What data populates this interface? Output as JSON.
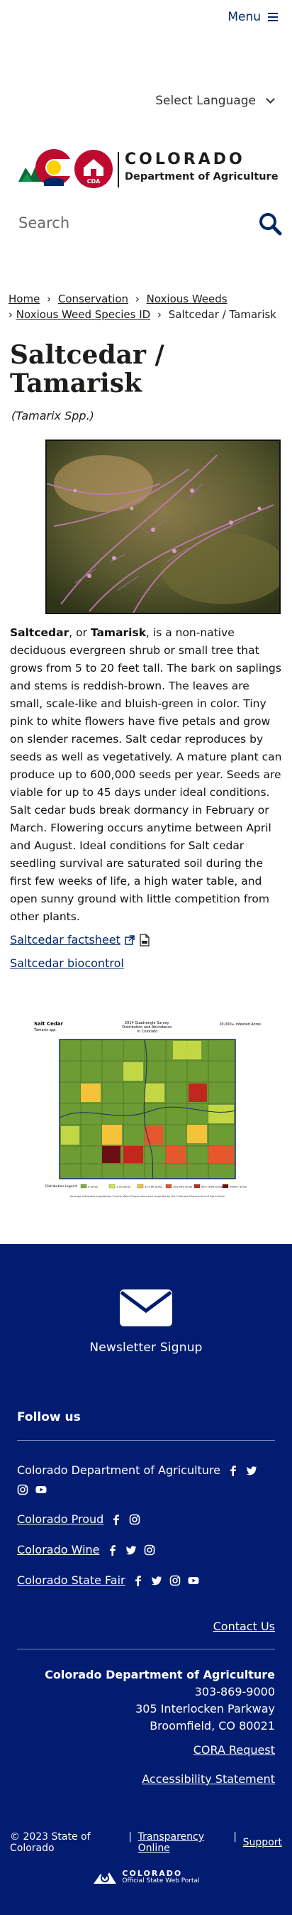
{
  "header": {
    "menu_label": "Menu",
    "language_label": "Select Language",
    "logo_line1": "COLORADO",
    "logo_line2": "Department of Agriculture",
    "logo_badge": "CDA",
    "search_placeholder": "Search"
  },
  "breadcrumb": {
    "items": [
      "Home",
      "Conservation",
      "Noxious Weeds",
      "Noxious Weed Species ID"
    ],
    "current": "Saltcedar / Tamarisk",
    "separator": "›"
  },
  "main": {
    "title": "Saltcedar / Tamarisk",
    "scientific_name": "(Tamarix Spp.)",
    "description_bold1": "Saltcedar",
    "description_mid": ", or ",
    "description_bold2": "Tamarisk",
    "description_rest": ", is a non-native deciduous evergreen shrub or small tree that grows from 5 to 20 feet tall. The bark on saplings and stems is reddish-brown. The leaves are small, scale-like and bluish-green in color. Tiny pink to white flowers have five petals and grow on slender racemes. Salt cedar reproduces by seeds as well as vegetatively. A mature plant can produce up to 600,000 seeds per year. Seeds are viable for up to 45 days under ideal conditions. Salt cedar buds break dormancy in February or March. Flowering occurs anytime between April and August. Ideal conditions for Salt cedar seedling survival are saturated soil during the first few weeks of life, a high water table, and open sunny ground with little competition from other plants.",
    "factsheet_link": "Saltcedar factsheet",
    "biocontrol_link": "Saltcedar biocontrol",
    "map": {
      "title_left": "Salt Cedar",
      "subtitle_left": "Tamarix spp.",
      "title_center": "2014 Quadrangle Survey\nDistribution and Abundance\nIn Colorado",
      "title_right": "20,000+ infested Acres",
      "legend_title": "Distribution Legend:",
      "legend": [
        {
          "label": "0 acres",
          "color": "#7fb03a"
        },
        {
          "label": "1-10 acres",
          "color": "#d8e64a"
        },
        {
          "label": "11-100 acres",
          "color": "#f3c33a"
        },
        {
          "label": "101-500 acres",
          "color": "#e5572c"
        },
        {
          "label": "501-1000 acres",
          "color": "#c0281e"
        },
        {
          "label": "1000+ acres",
          "color": "#6a0f12"
        }
      ],
      "footnote": "Acreage estimates supplied by County Weed Supervisors and compiled by the Colorado Department of Agriculture"
    }
  },
  "footer": {
    "newsletter_label": "Newsletter Signup",
    "follow_title": "Follow us",
    "follow_items": [
      {
        "name": "Colorado Department of Agriculture",
        "underline": false
      },
      {
        "name": "Colorado Proud",
        "underline": true
      },
      {
        "name": "Colorado Wine",
        "underline": true
      },
      {
        "name": "Colorado State Fair",
        "underline": true
      }
    ],
    "contact_link": "Contact Us",
    "org_name": "Colorado Department of Agriculture",
    "phone": "303-869-9000",
    "street": "305 Interlocken Parkway",
    "city": "Broomfield, CO 80021",
    "cora_link": "CORA Request",
    "accessibility_link": "Accessibility Statement",
    "copyright": "© 2023 State of Colorado",
    "transparency_link": "Transparency Online",
    "support_link": "Support",
    "portal_line1": "COLORADO",
    "portal_line2": "Official State Web Portal"
  },
  "colors": {
    "brand_blue": "#002868",
    "footer_bg": "#021c72",
    "co_red": "#bf0a30",
    "co_gold": "#ffd100"
  }
}
